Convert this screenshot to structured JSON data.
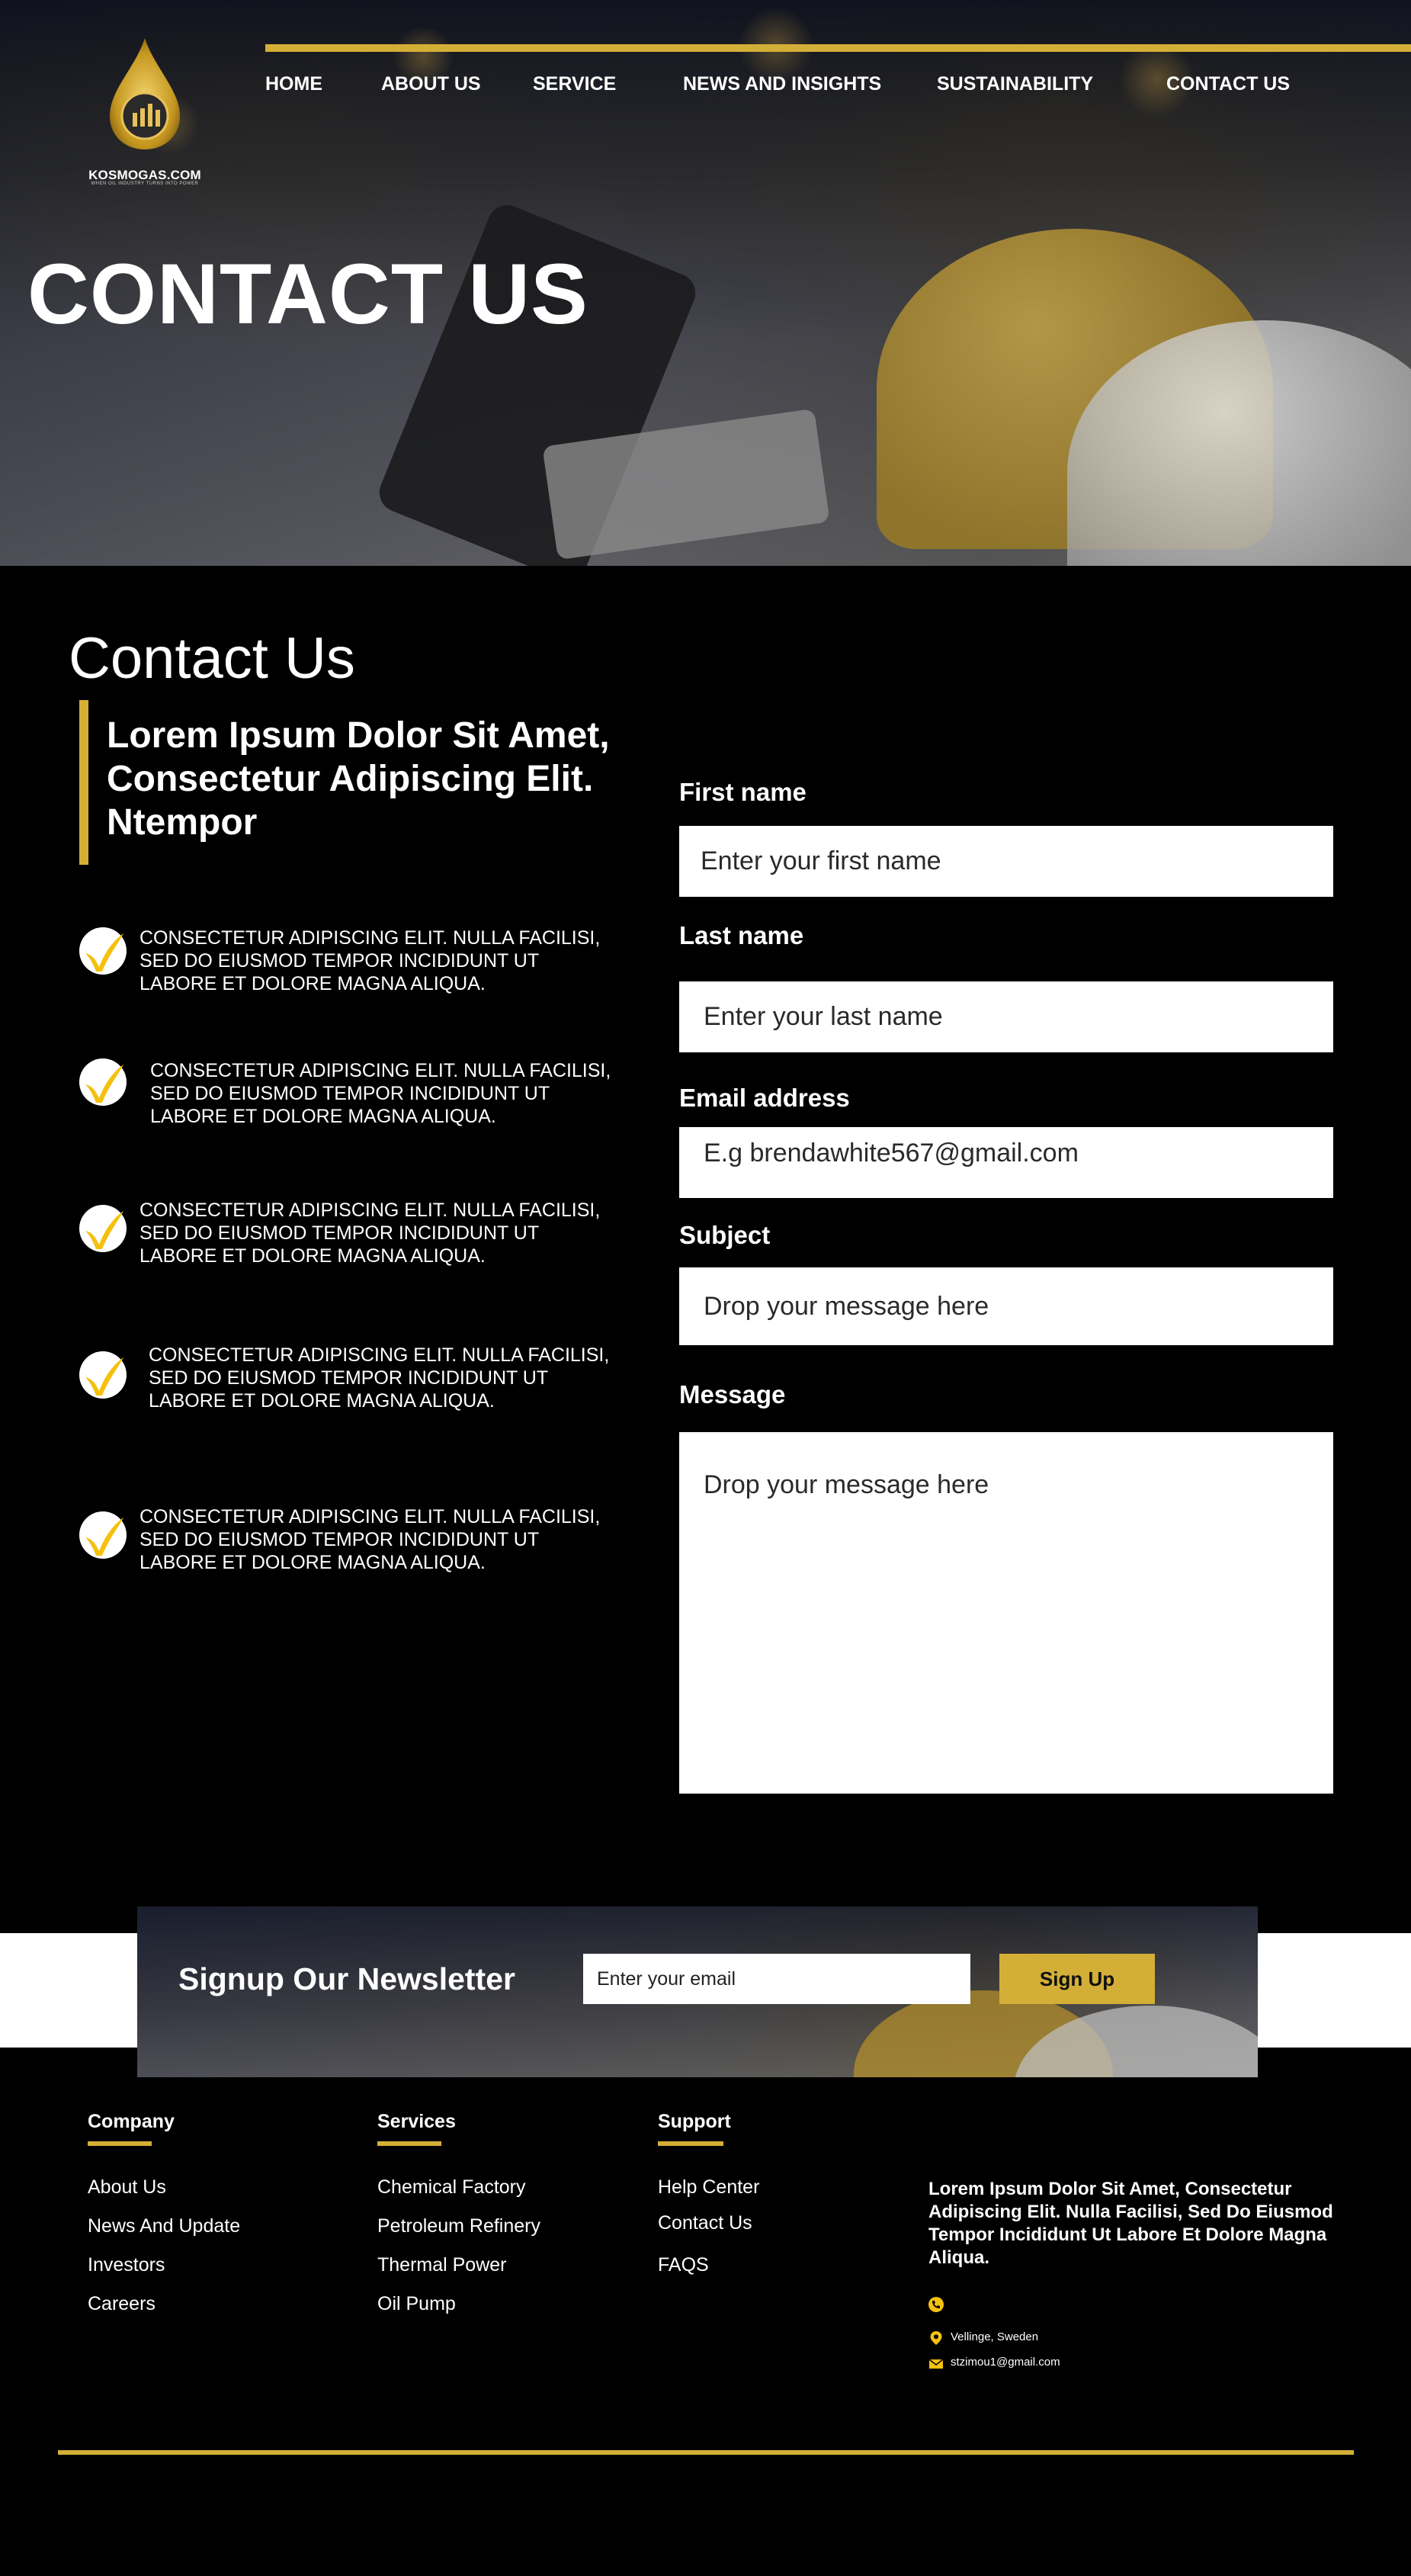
{
  "brand": {
    "name": "KOSMOGAS.COM",
    "tagline": "WHEN OIL INDUSTRY TURNS INTO POWER",
    "accent": "#d4af37"
  },
  "nav": {
    "items": [
      {
        "label": "HOME"
      },
      {
        "label": "ABOUT US"
      },
      {
        "label": "SERVICE"
      },
      {
        "label": "NEWS AND INSIGHTS"
      },
      {
        "label": "SUSTAINABILITY"
      },
      {
        "label": "CONTACT US"
      }
    ]
  },
  "hero": {
    "title": "CONTACT US"
  },
  "contact": {
    "heading": "Contact Us",
    "quote": "Lorem Ipsum Dolor Sit Amet, Consectetur Adipiscing Elit. Ntempor",
    "features": [
      "CONSECTETUR ADIPISCING ELIT. NULLA FACILISI, SED DO EIUSMOD TEMPOR INCIDIDUNT UT LABORE ET DOLORE MAGNA ALIQUA.",
      "CONSECTETUR ADIPISCING ELIT. NULLA FACILISI, SED DO EIUSMOD TEMPOR INCIDIDUNT UT LABORE ET DOLORE MAGNA ALIQUA.",
      "CONSECTETUR ADIPISCING ELIT. NULLA FACILISI, SED DO EIUSMOD TEMPOR INCIDIDUNT UT LABORE ET DOLORE MAGNA ALIQUA.",
      "CONSECTETUR ADIPISCING ELIT. NULLA FACILISI, SED DO EIUSMOD TEMPOR INCIDIDUNT UT LABORE ET DOLORE MAGNA ALIQUA.",
      "CONSECTETUR ADIPISCING ELIT. NULLA FACILISI, SED DO EIUSMOD TEMPOR INCIDIDUNT UT LABORE ET DOLORE MAGNA ALIQUA."
    ],
    "form": {
      "first_name_label": "First name",
      "first_name_placeholder": "Enter your first name",
      "last_name_label": "Last name",
      "last_name_placeholder": "Enter your last name",
      "email_label": "Email address",
      "email_placeholder": "E.g brendawhite567@gmail.com",
      "subject_label": "Subject",
      "subject_placeholder": "Drop your message here",
      "message_label": "Message",
      "message_placeholder": "Drop your message here"
    }
  },
  "newsletter": {
    "title": "Signup Our Newsletter",
    "email_placeholder": "Enter your email",
    "button_label": "Sign Up"
  },
  "footer": {
    "company": {
      "heading": "Company",
      "links": [
        "About Us",
        "News And Update",
        "Investors",
        "Careers"
      ]
    },
    "services": {
      "heading": "Services",
      "links": [
        "Chemical Factory",
        "Petroleum Refinery",
        "Thermal Power",
        "Oil Pump"
      ]
    },
    "support": {
      "heading": "Support",
      "links": [
        "Help Center",
        "Contact Us",
        "FAQS"
      ]
    },
    "about": "Lorem Ipsum Dolor Sit Amet, Consectetur Adipiscing Elit. Nulla Facilisi, Sed Do Eiusmod Tempor Incididunt Ut Labore Et Dolore Magna Aliqua.",
    "location": "Vellinge, Sweden",
    "email": "stzimou1@gmail.com"
  }
}
